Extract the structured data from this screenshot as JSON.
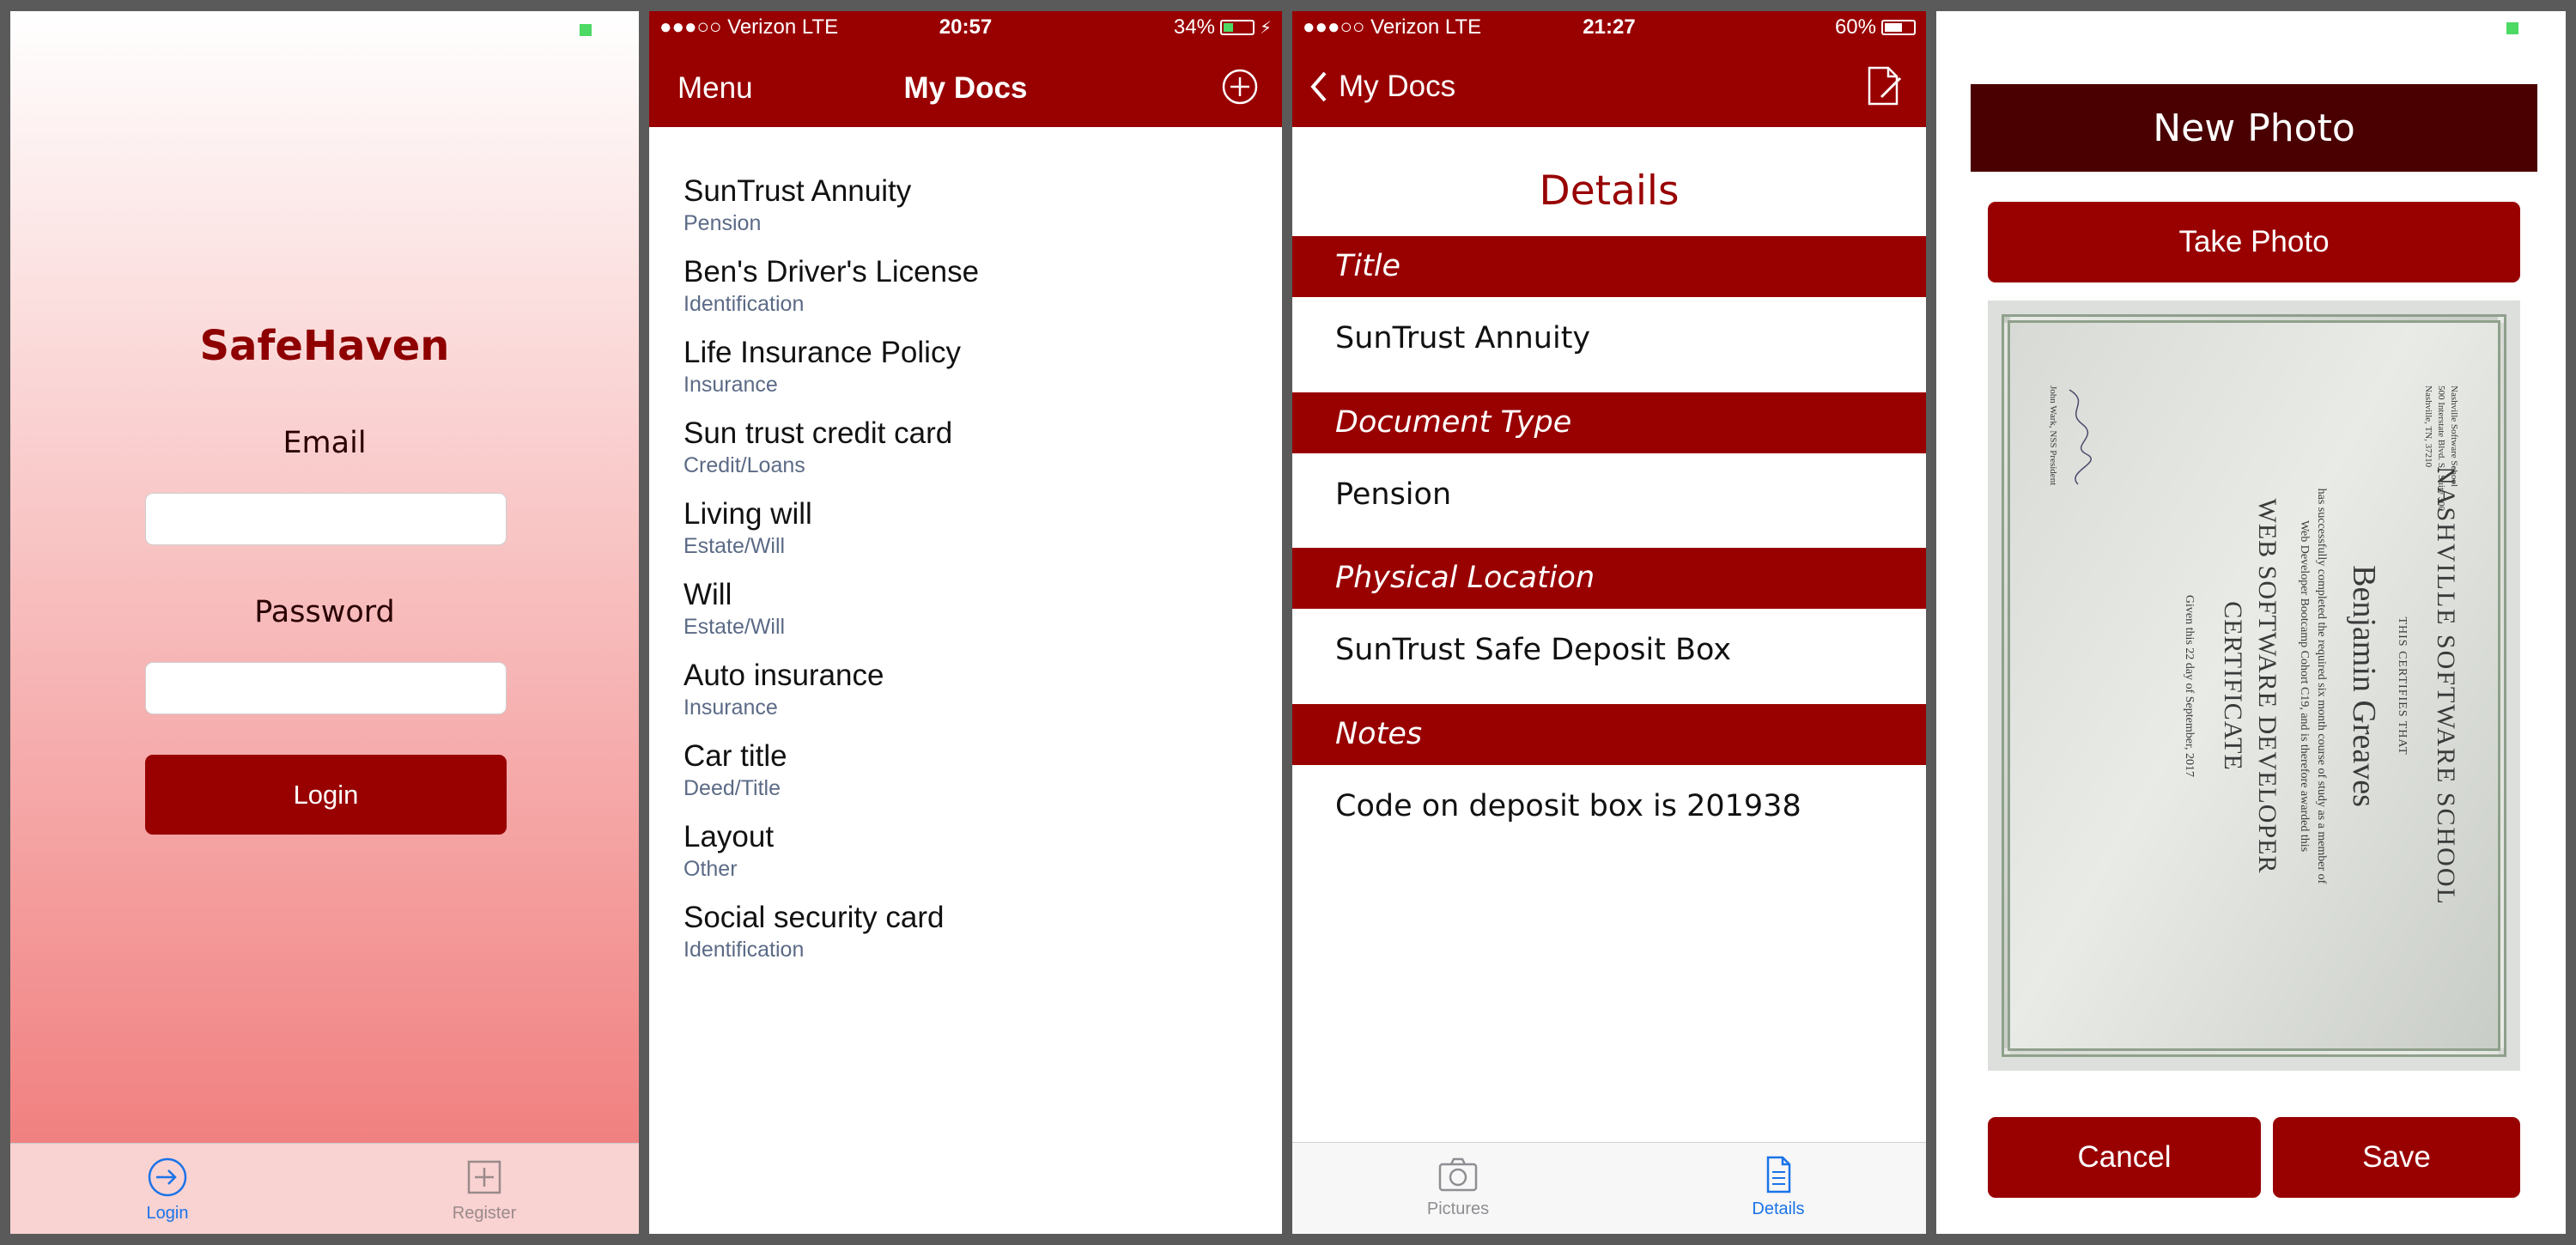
{
  "login_screen": {
    "app_name": "SafeHaven",
    "email_label": "Email",
    "password_label": "Password",
    "login_button": "Login",
    "tabs": [
      {
        "label": "Login",
        "icon": "login-arrow-icon",
        "color": "#1a73e8"
      },
      {
        "label": "Register",
        "icon": "plus-square-icon",
        "color": "#9a8a8a"
      }
    ]
  },
  "docs_screen": {
    "status": {
      "carrier": "●●●○○ Verizon  LTE",
      "time": "20:57",
      "battery": "34%",
      "battery_level": 0.34
    },
    "nav": {
      "left": "Menu",
      "title": "My Docs",
      "right_icon": "add-circle-icon"
    },
    "documents": [
      {
        "title": "SunTrust Annuity",
        "type": "Pension"
      },
      {
        "title": "Ben's Driver's License",
        "type": "Identification"
      },
      {
        "title": "Life Insurance Policy",
        "type": "Insurance"
      },
      {
        "title": "Sun trust credit card",
        "type": "Credit/Loans"
      },
      {
        "title": "Living will",
        "type": "Estate/Will"
      },
      {
        "title": "Will",
        "type": "Estate/Will"
      },
      {
        "title": "Auto insurance",
        "type": "Insurance"
      },
      {
        "title": "Car title",
        "type": "Deed/Title"
      },
      {
        "title": "Layout",
        "type": "Other"
      },
      {
        "title": "Social security card",
        "type": "Identification"
      }
    ]
  },
  "details_screen": {
    "status": {
      "carrier": "●●●○○ Verizon  LTE",
      "time": "21:27",
      "battery": "60%",
      "battery_level": 0.6
    },
    "nav": {
      "back": "My Docs",
      "right_icon": "edit-document-icon"
    },
    "heading": "Details",
    "sections": [
      {
        "label": "Title",
        "value": "SunTrust Annuity"
      },
      {
        "label": "Document Type",
        "value": "Pension"
      },
      {
        "label": "Physical Location",
        "value": "SunTrust Safe Deposit Box"
      },
      {
        "label": "Notes",
        "value": "Code on deposit box is 201938"
      }
    ],
    "tabs": [
      {
        "label": "Pictures",
        "icon": "camera-icon",
        "color": "#8e8e93"
      },
      {
        "label": "Details",
        "icon": "document-icon",
        "color": "#1a73e8"
      }
    ]
  },
  "new_photo_screen": {
    "header": "New Photo",
    "take_photo_button": "Take Photo",
    "cancel_button": "Cancel",
    "save_button": "Save",
    "certificate": {
      "school": "NASHVILLE SOFTWARE SCHOOL",
      "certifies": "THIS CERTIFIES THAT",
      "name": "Benjamin Greaves",
      "body_1": "has successfully completed the required six month course of study as a member of",
      "body_2": "Web Developer Bootcamp Cohort C19, and is therefore awarded this",
      "title_1": "WEB SOFTWARE DEVELOPER",
      "title_2": "CERTIFICATE",
      "given": "Given this 22 day of September, 2017",
      "address_1": "Nashville Software School",
      "address_2": "500 Interstate Blvd. S., Suite 300",
      "address_3": "Nashville, TN, 37210",
      "signer": "John Wark, NSS President"
    }
  },
  "colors": {
    "brand": "#990000",
    "brand_dark": "#4a0000",
    "link": "#1a73e8"
  }
}
